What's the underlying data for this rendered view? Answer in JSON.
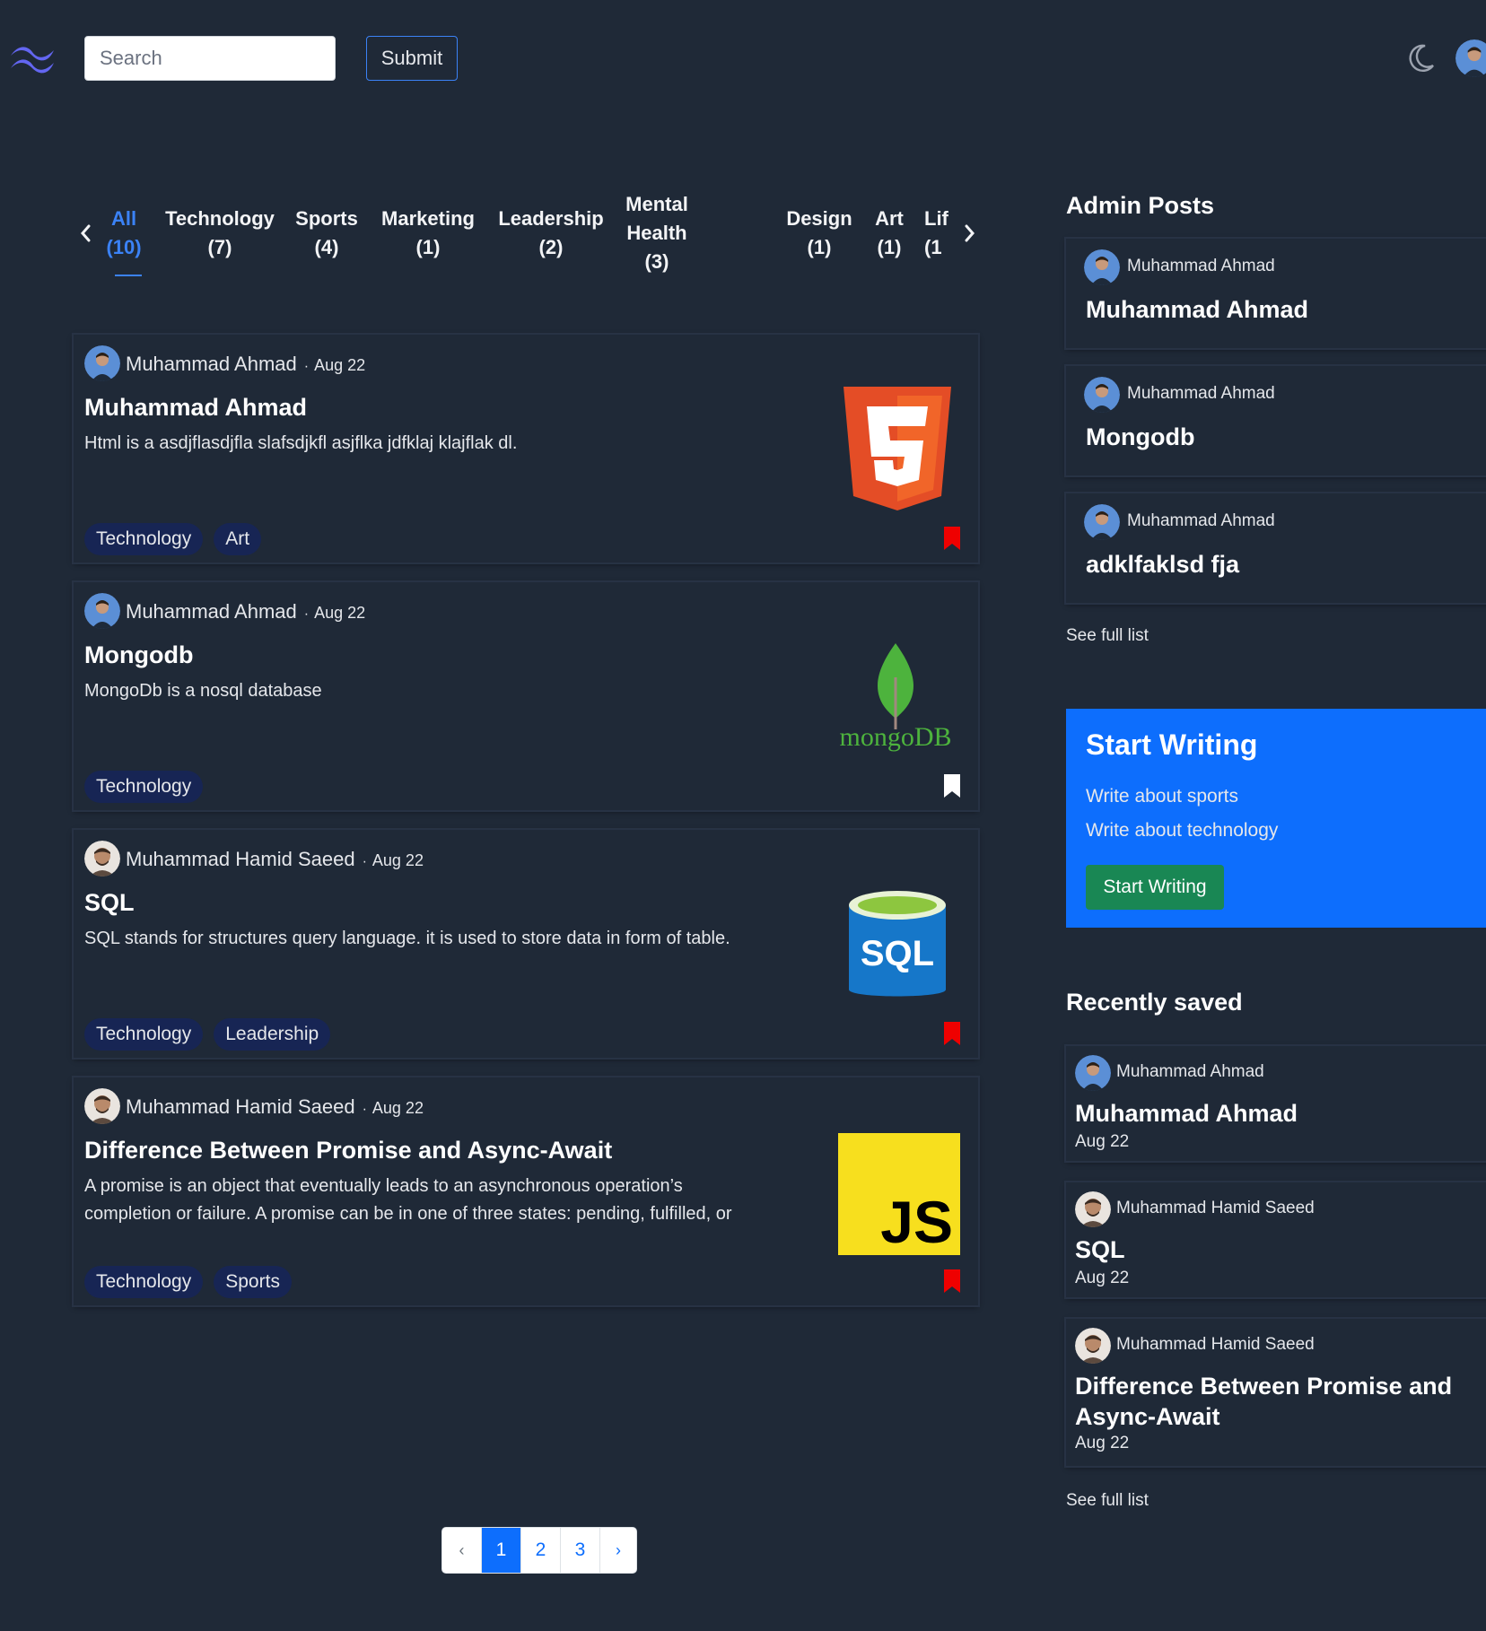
{
  "header": {
    "logo_icon": "tailwind-wave-logo",
    "search_placeholder": "Search",
    "submit_label": "Submit",
    "theme_icon": "moon-icon"
  },
  "categories": [
    {
      "name": "All",
      "count": "(10)",
      "active": true
    },
    {
      "name": "Technology",
      "count": "(7)"
    },
    {
      "name": "Sports",
      "count": "(4)"
    },
    {
      "name": "Marketing",
      "count": "(1)"
    },
    {
      "name": "Leadership",
      "count": "(2)"
    },
    {
      "name": "Mental",
      "name2": "Health",
      "count": "(3)"
    },
    {
      "name": "Design",
      "count": "(1)"
    },
    {
      "name": "Art",
      "count": "(1)"
    },
    {
      "name": "Lif",
      "count": "(1"
    }
  ],
  "posts": [
    {
      "author": "Muhammad Ahmad",
      "date": "Aug 22",
      "title": "Muhammad Ahmad",
      "excerpt": "Html is a asdjflasdjfla slafsdjkfl asjflka jdfklaj klajflak dl.",
      "tags": [
        "Technology",
        "Art"
      ],
      "image": "html5-logo",
      "saved": true
    },
    {
      "author": "Muhammad Ahmad",
      "date": "Aug 22",
      "title": "Mongodb",
      "excerpt": "MongoDb is a nosql database",
      "tags": [
        "Technology"
      ],
      "image": "mongodb-logo",
      "image_text": "mongoDB",
      "saved": false
    },
    {
      "author": "Muhammad Hamid Saeed",
      "date": "Aug 22",
      "title": "SQL",
      "excerpt": "SQL stands for structures query language. it is used to store data in form of table.",
      "tags": [
        "Technology",
        "Leadership"
      ],
      "image": "sql-database-icon",
      "image_text": "SQL",
      "saved": true
    },
    {
      "author": "Muhammad Hamid Saeed",
      "date": "Aug 22",
      "title": "Difference Between Promise and Async-Await",
      "excerpt": "A promise is an object that eventually leads to an asynchronous operation’s completion or failure. A promise can be in one of three states: pending, fulfilled, or",
      "tags": [
        "Technology",
        "Sports"
      ],
      "image": "javascript-logo",
      "image_text": "JS",
      "saved": true
    }
  ],
  "admin_posts": {
    "heading": "Admin Posts",
    "items": [
      {
        "author": "Muhammad Ahmad",
        "title": "Muhammad Ahmad"
      },
      {
        "author": "Muhammad Ahmad",
        "title": "Mongodb"
      },
      {
        "author": "Muhammad Ahmad",
        "title": "adklfaklsd fja"
      }
    ],
    "see_full": "See full list"
  },
  "start_writing": {
    "heading": "Start Writing",
    "line1": "Write about sports",
    "line2": "Write about technology",
    "button": "Start Writing"
  },
  "recently_saved": {
    "heading": "Recently saved",
    "items": [
      {
        "author": "Muhammad Ahmad",
        "title": "Muhammad Ahmad",
        "date": "Aug 22"
      },
      {
        "author": "Muhammad Hamid Saeed",
        "title": "SQL",
        "date": "Aug 22"
      },
      {
        "author": "Muhammad Hamid Saeed",
        "title": "Difference Between Promise and Async-Await",
        "date": "Aug 22"
      }
    ],
    "see_full": "See full list"
  },
  "pagination": {
    "prev": "‹",
    "pages": [
      "1",
      "2",
      "3"
    ],
    "next": "›",
    "current": "1"
  },
  "colors": {
    "background": "#1f2937",
    "accent": "#0d6efd",
    "tag_bg": "#172554",
    "bookmark_saved": "#ef0000",
    "bookmark_unsaved": "#ffffff",
    "start_writing_btn": "#198754"
  }
}
